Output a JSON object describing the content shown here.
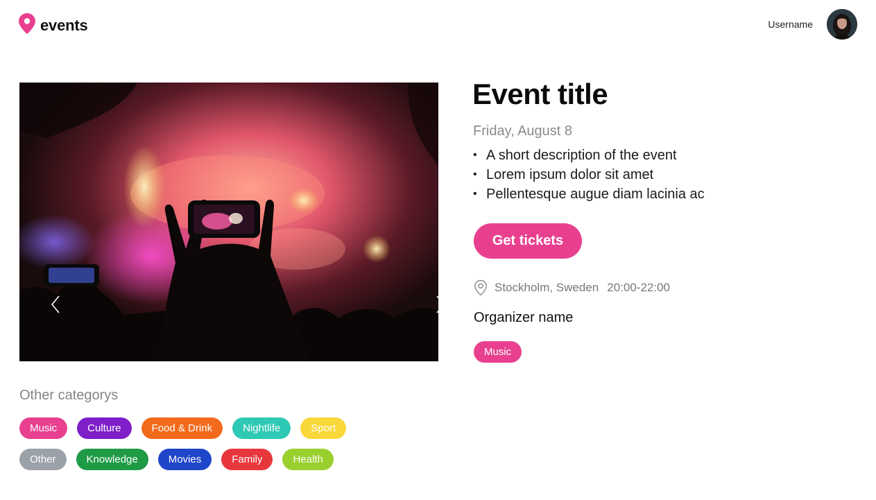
{
  "header": {
    "logo_text": "events",
    "username": "Username"
  },
  "carousel": {
    "prev_icon": "chevron-left-icon",
    "next_icon": "chevron-right-icon"
  },
  "event": {
    "title": "Event title",
    "date": "Friday, August 8",
    "description": [
      "A short description of the event",
      "Lorem ipsum dolor sit amet",
      "Pellentesque augue diam lacinia ac"
    ],
    "cta_label": "Get tickets",
    "location": "Stockholm, Sweden",
    "time": "20:00-22:00",
    "organizer": "Organizer name",
    "tag": "Music"
  },
  "categories": {
    "title": "Other categorys",
    "row1": [
      "Music",
      "Culture",
      "Food & Drink",
      "Nightlife",
      "Sport"
    ],
    "row2": [
      "Other",
      "Knowledge",
      "Movies",
      "Family",
      "Health"
    ]
  },
  "colors": {
    "brand": "#e8408f",
    "Music": "#e8408f",
    "Culture": "#7e1fc9",
    "Food & Drink": "#f26a1b",
    "Nightlife": "#2ec9b5",
    "Sport": "#f8d83a",
    "Other": "#9aa1a8",
    "Knowledge": "#1f9a45",
    "Movies": "#1f45c9",
    "Family": "#e8363d",
    "Health": "#9ad02e"
  }
}
